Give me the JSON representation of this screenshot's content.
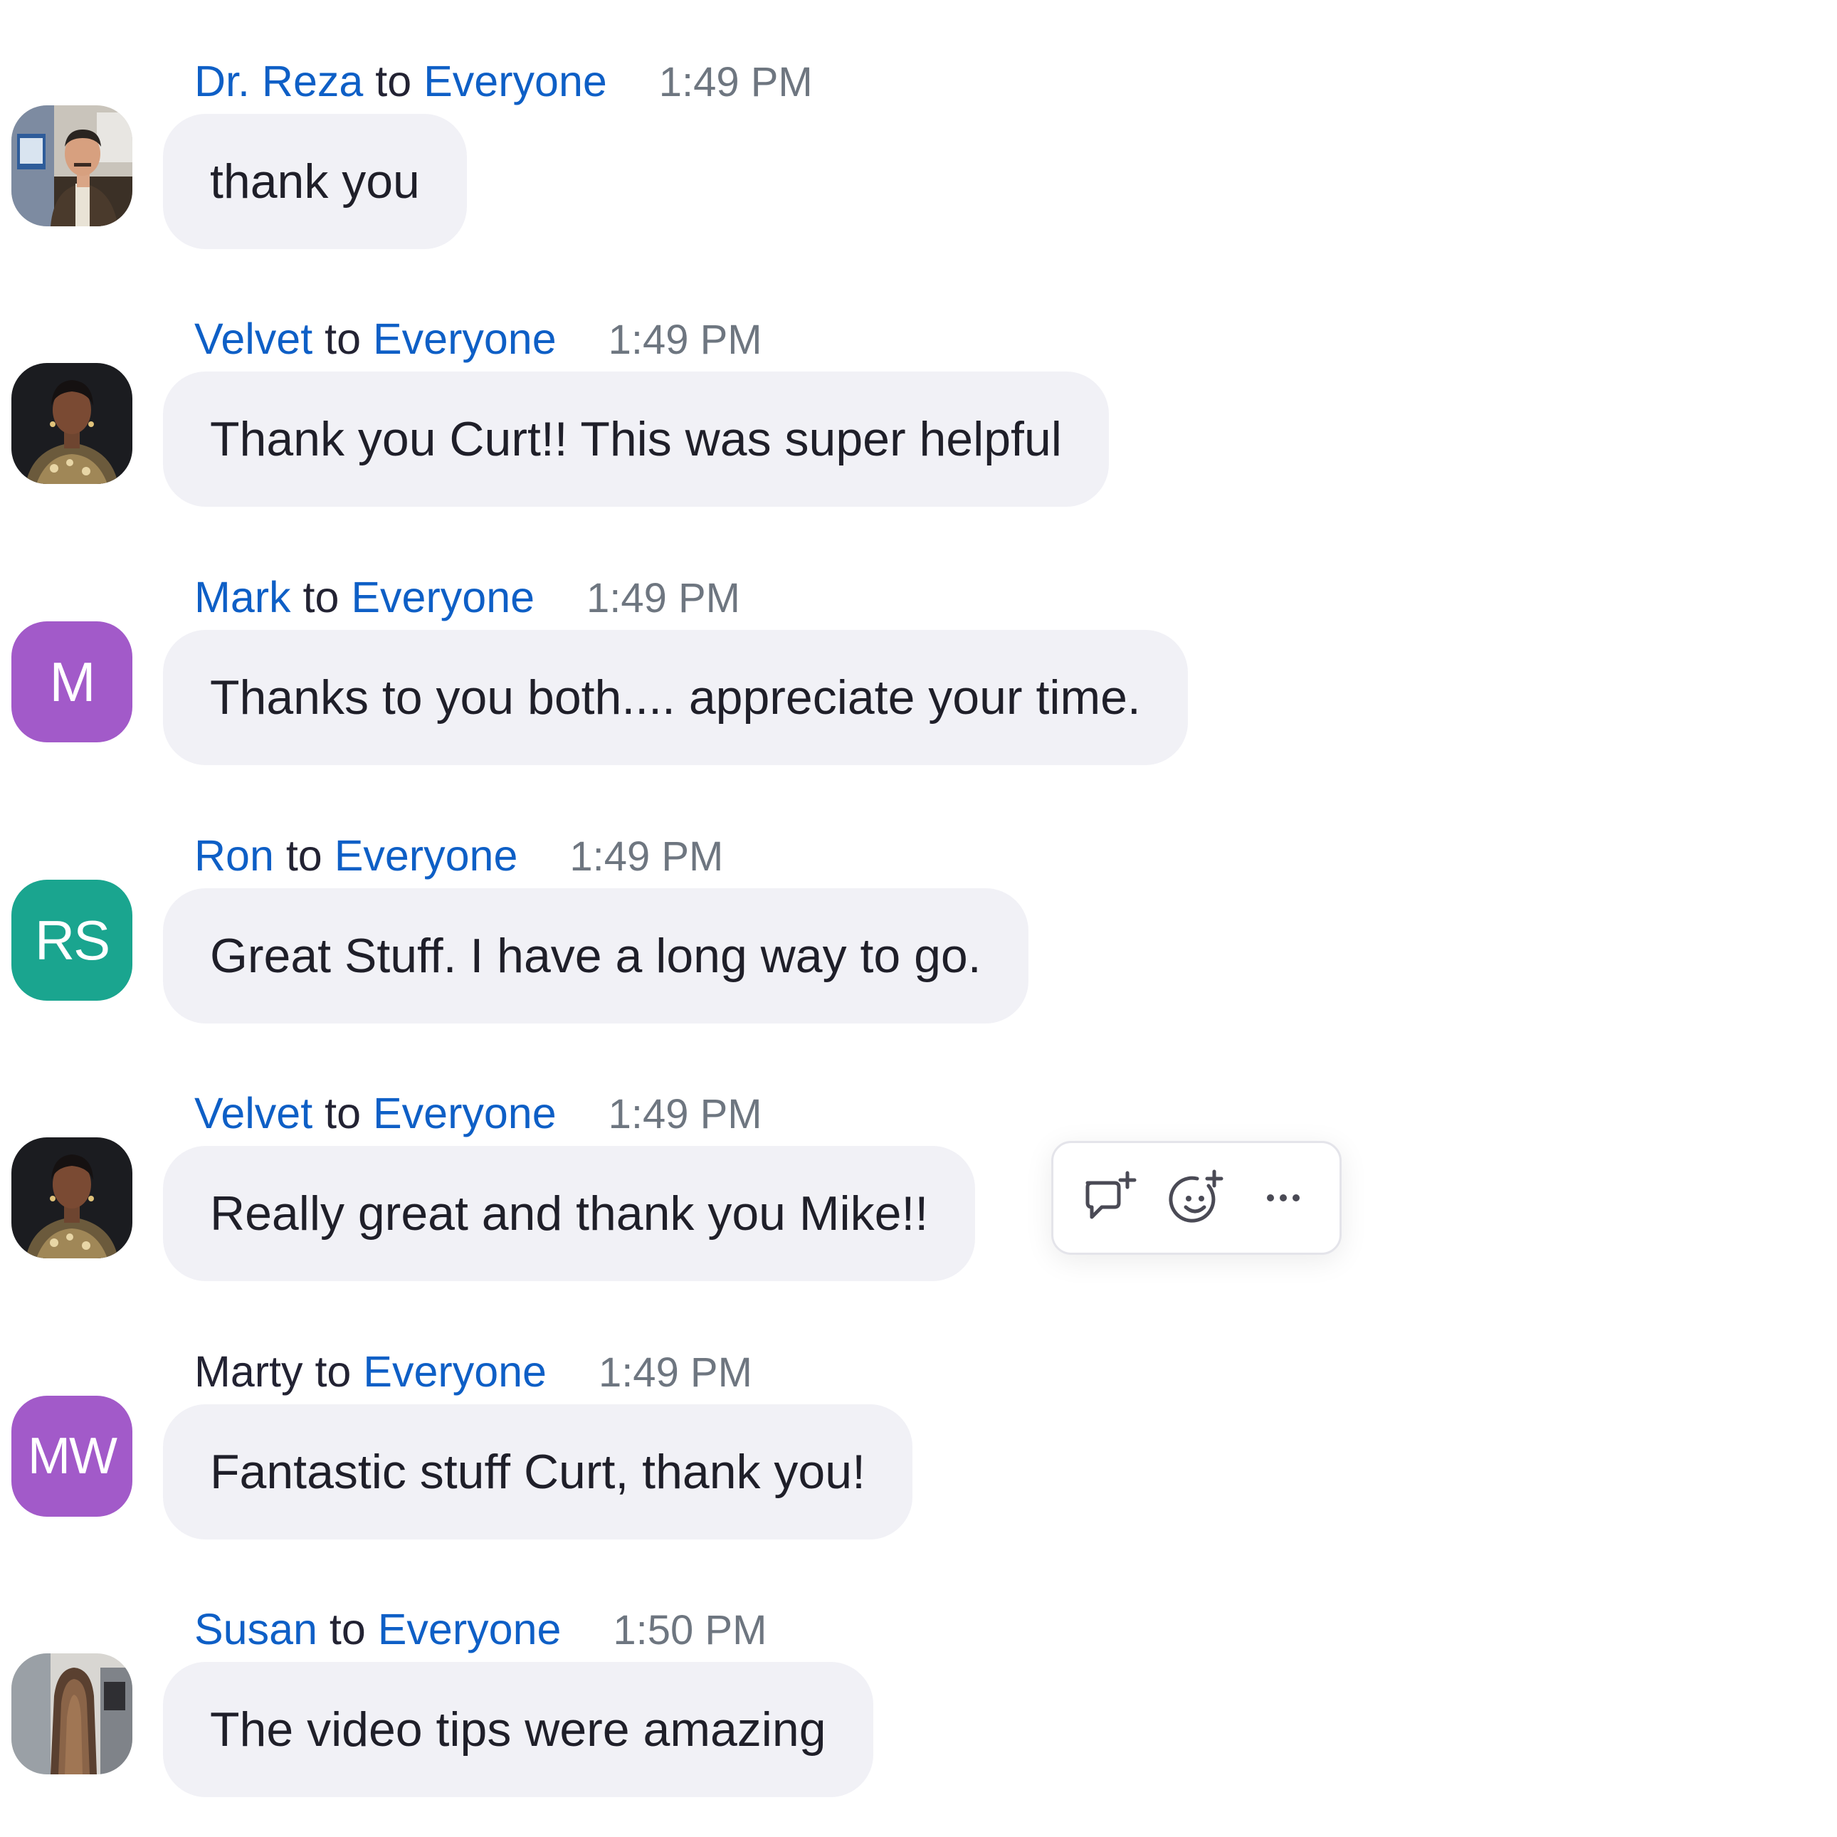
{
  "chat": {
    "messages": [
      {
        "sender": "Dr. Reza",
        "to": "to",
        "target": "Everyone",
        "time": "1:49 PM",
        "text": "thank you",
        "avatar": {
          "type": "photo",
          "icon": "photo-avatar-man"
        }
      },
      {
        "sender": "Velvet",
        "to": "to",
        "target": "Everyone",
        "time": "1:49 PM",
        "text": "Thank you Curt!! This was super helpful",
        "avatar": {
          "type": "photo",
          "icon": "photo-avatar-woman"
        }
      },
      {
        "sender": "Mark",
        "to": "to",
        "target": "Everyone",
        "time": "1:49 PM",
        "text": "Thanks to you both.... appreciate your time.",
        "avatar": {
          "type": "initials",
          "initials": "M",
          "color": "#a25ac9"
        }
      },
      {
        "sender": "Ron",
        "to": "to",
        "target": "Everyone",
        "time": "1:49 PM",
        "text": "Great Stuff. I have a long way to go.",
        "avatar": {
          "type": "initials",
          "initials": "RS",
          "color": "#1aa58f"
        }
      },
      {
        "sender": "Velvet",
        "to": "to",
        "target": "Everyone",
        "time": "1:49 PM",
        "text": "Really great and thank you Mike!!",
        "avatar": {
          "type": "photo",
          "icon": "photo-avatar-woman"
        }
      },
      {
        "sender": "Marty",
        "to": "to",
        "target": "Everyone",
        "time": "1:49 PM",
        "text": "Fantastic stuff Curt, thank you!",
        "avatar": {
          "type": "initials",
          "initials": "MW",
          "color": "#a25ac9"
        }
      },
      {
        "sender": "Susan",
        "to": "to",
        "target": "Everyone",
        "time": "1:50 PM",
        "text": "The video tips were amazing",
        "avatar": {
          "type": "photo",
          "icon": "photo-avatar-long-hair"
        }
      }
    ],
    "hover_actions": {
      "reply_icon": "reply-thread-icon",
      "reaction_icon": "add-reaction-icon",
      "more_icon": "more-options-icon"
    },
    "colors": {
      "link_blue": "#0e5fc6",
      "bubble_bg": "#f1f1f6",
      "time_gray": "#6e7680"
    }
  }
}
